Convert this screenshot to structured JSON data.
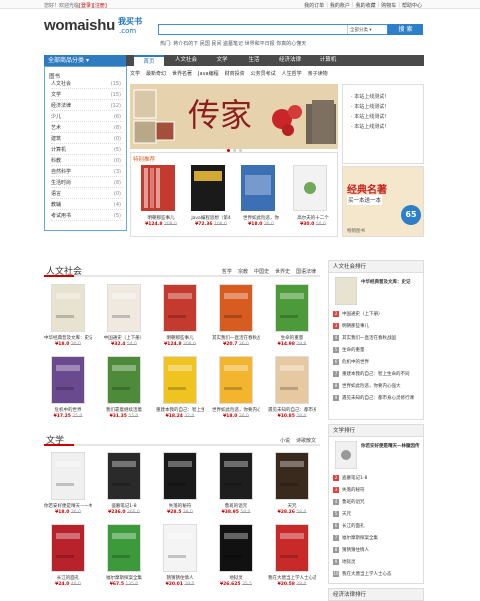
{
  "topbar": {
    "welcome": "您好！欢迎光临",
    "login": "[登录]",
    "register": "[注册]",
    "links": [
      "我的订单",
      "我的账户",
      "我的收藏",
      "购物车",
      "帮助中心"
    ]
  },
  "logo": {
    "text": "womaishu",
    "cn": "我买书",
    "com": ".com"
  },
  "search": {
    "placeholder": "",
    "scope": "全部分类",
    "button": "搜 索"
  },
  "hotwords": "热门:  蒋介石的下 民国 民间 盗墓笔记 世界和平日报 你真的心懂天",
  "nav": {
    "category": "全部商品分类",
    "items": [
      "首页",
      "人文社会",
      "文学",
      "生活",
      "经济法律",
      "计算机"
    ],
    "active": 0
  },
  "subnav": [
    "文学",
    "最新奇幻",
    "世界名著",
    "Java编程",
    "财商投资",
    "公务员考试",
    "人生哲学",
    "亲子读物"
  ],
  "sidebar": {
    "heading": "图书",
    "items": [
      {
        "label": "人文社会",
        "count": "(15)"
      },
      {
        "label": "文学",
        "count": "(15)"
      },
      {
        "label": "经济法律",
        "count": "(12)"
      },
      {
        "label": "少儿",
        "count": "(6)"
      },
      {
        "label": "艺术",
        "count": "(8)"
      },
      {
        "label": "建筑",
        "count": "(0)"
      },
      {
        "label": "计算机",
        "count": "(5)"
      },
      {
        "label": "科教",
        "count": "(0)"
      },
      {
        "label": "自然科学",
        "count": "(3)"
      },
      {
        "label": "生活时尚",
        "count": "(8)"
      },
      {
        "label": "语言",
        "count": "(0)"
      },
      {
        "label": "教辅",
        "count": "(4)"
      },
      {
        "label": "考试用书",
        "count": "(5)"
      }
    ]
  },
  "banner": {
    "title": "传家"
  },
  "recommend": {
    "title": "特别推荐",
    "books": [
      {
        "name": "明朝那些事儿",
        "price": "¥124.8",
        "old": "208.0",
        "color": "#c53a2f"
      },
      {
        "name": "Java编程思想（第4",
        "price": "¥72.36",
        "old": "108.0",
        "color": "#1a1a1a"
      },
      {
        "name": "世界如此险恶，你",
        "price": "¥18.0",
        "old": "30.0",
        "color": "#3b6fb6"
      },
      {
        "name": "高尔夫的十二个",
        "price": "¥30.0",
        "old": "50.0",
        "color": "#f2f2f2"
      }
    ]
  },
  "notice": {
    "items": [
      "本站上线测试！",
      "本站上线测试！",
      "本站上线测试！",
      "本站上线测试！"
    ]
  },
  "promo": {
    "line1": "经典名著",
    "line2": "买一本送一本",
    "badge": "65",
    "caption": "畅销图书"
  },
  "sections": [
    {
      "title": "人文社会",
      "tabs": [
        "哲学",
        "宗教",
        "中国史",
        "世界史",
        "国语法律"
      ],
      "books": [
        {
          "name": "中华经典普及文库：史记",
          "price": "¥18.0",
          "old": "30.0",
          "color": "#e8e2d0"
        },
        {
          "name": "中国通史（上下册）",
          "price": "¥32.4",
          "old": "54.0",
          "color": "#efe9e0"
        },
        {
          "name": "明朝那些事儿",
          "price": "¥124.8",
          "old": "208.0",
          "color": "#c53a2f"
        },
        {
          "name": "其实我们一直活在春秋战国",
          "price": "¥20.7",
          "old": "36.0",
          "color": "#d85b1f"
        },
        {
          "name": "生命的重量",
          "price": "¥14.98",
          "old": "29.8",
          "color": "#4c9a3a"
        },
        {
          "name": "危机中的世界",
          "price": "¥17.25",
          "old": "25.0",
          "color": "#6a4a8f"
        },
        {
          "name": "我们靠着继续活着",
          "price": "¥31.35",
          "old": "55.0",
          "color": "#4d8a3a"
        },
        {
          "name": "重建本我的自己：智上生命",
          "price": "¥18.24",
          "old": "32.0",
          "color": "#f0c420"
        },
        {
          "name": "世界如此险恶，你要内心强大",
          "price": "¥18.0",
          "old": "30.0",
          "color": "#f3b52e"
        },
        {
          "name": "遇见未知的自己：都市身心灵",
          "price": "¥10.85",
          "old": "28.0",
          "color": "#e6c9a0"
        }
      ]
    },
    {
      "title": "文学",
      "tabs": [
        "小说",
        "诗歌散文"
      ],
      "books": [
        {
          "name": "你若安好便是晴天—一林",
          "price": "¥18.0",
          "old": "30.0",
          "color": "#f0f0f0"
        },
        {
          "name": "盗墓笔记1-8",
          "price": "¥236.0",
          "old": "360.0",
          "color": "#2a2a2a"
        },
        {
          "name": "失落的秘符",
          "price": "¥28.5",
          "old": "38.0",
          "color": "#1a1a1a"
        },
        {
          "name": "鲁班的诅咒",
          "price": "¥38.95",
          "old": "58.0",
          "color": "#1e1e1e"
        },
        {
          "name": "天咒",
          "price": "¥28.26",
          "old": "58.0",
          "color": "#3a2a1e"
        },
        {
          "name": "长江的面孔",
          "price": "¥24.0",
          "old": "40.0",
          "color": "#b8222a"
        },
        {
          "name": "福尔摩斯探案全集",
          "price": "¥67.5",
          "old": "135.0",
          "color": "#3c9a3a"
        },
        {
          "name": "猜猜猜住情人",
          "price": "¥20.01",
          "old": "29.0",
          "color": "#f4f4f4"
        },
        {
          "name": "地狱灵",
          "price": "¥26.625",
          "old": "35.5",
          "color": "#111111"
        },
        {
          "name": "我在大唐当上学人士心态",
          "price": "¥20.58",
          "old": "28.0",
          "color": "#c82a2a"
        }
      ]
    }
  ],
  "rankings": [
    {
      "title": "人文社会排行",
      "feature": "中华经典普及文库：史记",
      "items": [
        "中国通史（上下册）",
        "明朝那些事儿",
        "其实我们一直活在春秋战国",
        "生命的重量",
        "危机中的世界",
        "重建本我的自己：智上生命的不同",
        "世界如此险恶，你要内心强大",
        "遇见未知的自己：都市身心灵修行课"
      ]
    },
    {
      "title": "文学排行",
      "feature": "你若安好便是晴天—林徽因传",
      "items": [
        "盗墓笔记1-8",
        "失落的秘符",
        "鲁班的诅咒",
        "天咒",
        "长江的面孔",
        "福尔摩斯探案全集",
        "猜猜猜住情人",
        "地狱灵",
        "我在大唐当上学人士心态"
      ]
    },
    {
      "title": "经济法律排行",
      "feature": "",
      "items": []
    }
  ]
}
